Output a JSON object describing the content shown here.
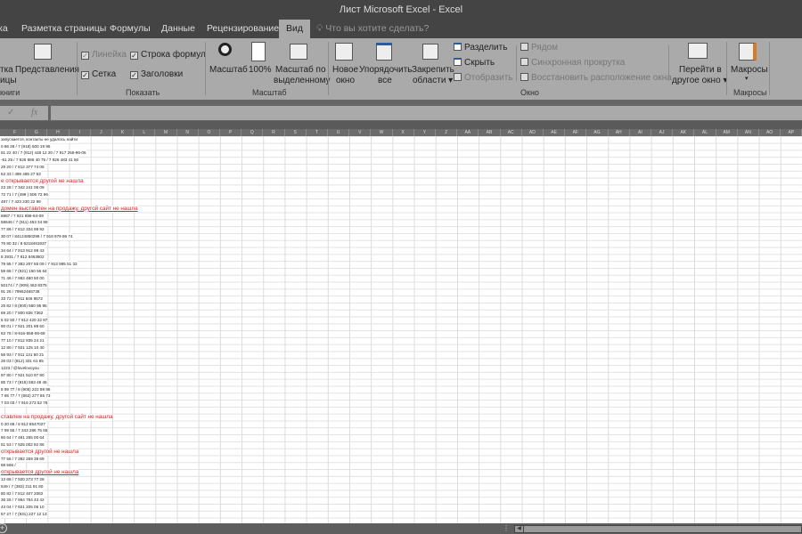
{
  "window": {
    "title": "Лист Microsoft Excel  -  Excel"
  },
  "tabs": [
    {
      "label": "ка"
    },
    {
      "label": "Разметка страницы"
    },
    {
      "label": "Формулы"
    },
    {
      "label": "Данные"
    },
    {
      "label": "Рецензирование"
    },
    {
      "label": "Вид",
      "active": true
    }
  ],
  "tell_me": "Что вы хотите сделать?",
  "ribbon": {
    "views": {
      "btn1": "тка",
      "btn1b": "ицы",
      "btn2": "Представления",
      "group": "книги"
    },
    "show": {
      "ruler": "Линейка",
      "formula_bar": "Строка формул",
      "gridlines": "Сетка",
      "headings": "Заголовки",
      "group": "Показать"
    },
    "zoom": {
      "zoom": "Масштаб",
      "p100": "100%",
      "sel1": "Масштаб по",
      "sel2": "выделенному",
      "group": "Масштаб"
    },
    "window": {
      "new1": "Новое",
      "new2": "окно",
      "arr1": "Упорядочить",
      "arr2": "все",
      "freeze1": "Закрепить",
      "freeze2": "области",
      "split": "Разделить",
      "hide": "Скрыть",
      "unhide": "Отобразить",
      "side": "Рядом",
      "sync": "Синхронная прокрутка",
      "reset": "Восстановить расположение окна",
      "switch1": "Перейти в",
      "switch2": "другое окно",
      "group": "Окно"
    },
    "macros": {
      "label": "Макросы",
      "group": "Макросы"
    }
  },
  "formula_bar": {
    "fx": "fx",
    "check": "✓",
    "value": ""
  },
  "columns": [
    "F",
    "G",
    "H",
    "I",
    "J",
    "K",
    "L",
    "M",
    "N",
    "O",
    "P",
    "Q",
    "R",
    "S",
    "T",
    "U",
    "V",
    "W",
    "X",
    "Y",
    "Z",
    "AA",
    "AB",
    "AC",
    "AD",
    "AE",
    "AF",
    "AG",
    "AH",
    "AI",
    "AJ",
    "AK",
    "AL",
    "AM",
    "AN",
    "AO",
    "AP"
  ],
  "rows": [
    {
      "text": "запускается, контакты не удалось найти"
    },
    {
      "text": "0 86 28 / 7 (918) 500 19 95"
    },
    {
      "text": "61 22 40 / 7 (812) 448 12 20 / 7 917 255-96-06"
    },
    {
      "text": "-61 25 / 7 926 886 40 75 / 7 926 483 41 50"
    },
    {
      "text": "29 20 / 7 812 377 74 06"
    },
    {
      "text": "53 33 / 499 485 27 53"
    },
    {
      "text": "е открывается другой не нашла",
      "red": true
    },
    {
      "text": "23 28 / 7 342 241 05 09"
    },
    {
      "text": "72 71 / 7 (499 ) 506 72 96"
    },
    {
      "text": "487 / 7 423 230 22 99"
    },
    {
      "text": " домен выставлен на продажу, другой сайт не нашла",
      "red": true,
      "u": true
    },
    {
      "text": "6887 / 7 921 896-84-09"
    },
    {
      "text": "58646 / 7 (911) 463 34 98"
    },
    {
      "text": "77 89 / 7 812 334 98 92"
    },
    {
      "text": "30 07 / 84124850298 / 7 918 979 86 74"
    },
    {
      "text": "76 80 32 / 8 9218461937"
    },
    {
      "text": "34 64 / 7 913 912 99 43"
    },
    {
      "text": "8 2931 / 7 812 8463802"
    },
    {
      "text": "79 95 / 7 383 207 55 09 / 7 913 985 51 33"
    },
    {
      "text": "59 68 / 7 (921) 150 56 64"
    },
    {
      "text": "71 46 / 7 962 480 50 00"
    },
    {
      "text": "50174 / 7 (909) 463 8375"
    },
    {
      "text": "91 26 / 79952465738"
    },
    {
      "text": "33 73 / 7 911 846 9572"
    },
    {
      "text": "25 82 / 8 (800) 550 95 95"
    },
    {
      "text": "69 20 / 7 800 836 7362"
    },
    {
      "text": "5 02 50 / 7 812 420 22 87"
    },
    {
      "text": "90 01 / 7 921 201 89 60"
    },
    {
      "text": "63 78 / 8-916-558-06-68"
    },
    {
      "text": "77 10 / 7 812 935 24 21"
    },
    {
      "text": "12 80 / 7 921 125 10 40"
    },
    {
      "text": "56 93 / 7 911 131 50 21"
    },
    {
      "text": "26 03 / (812) 331 61 85"
    },
    {
      "text": "1223 / @lovelovoyou"
    },
    {
      "text": "97 80 / 7 921 510 97 80"
    },
    {
      "text": "85 73 / 7 (916) 563 49 45"
    },
    {
      "text": "8 99 77 / 8 (905) 222 88 86"
    },
    {
      "text": "7 65 77 / 7 (862) 277 65 73"
    },
    {
      "text": "7 03 03 / 7 916 273 52 76"
    },
    {
      "text": ""
    },
    {
      "text": "ставлен на продажу, другой сайт не нашла",
      "red": true
    },
    {
      "text": "0 20 68 / 8 812 8547027"
    },
    {
      "text": "7 99 55 / 7 343 286 75 55"
    },
    {
      "text": "60 64 / 7 481 265 00 64"
    },
    {
      "text": "51 53 / 7 925 002 92 86"
    },
    {
      "text": " открывается другой не нашла",
      "red": true
    },
    {
      "text": "77 56 / 7 382 259 39 69"
    },
    {
      "text": "88 566 /"
    },
    {
      "text": " открывается другой не нашла",
      "red": true,
      "u": true
    },
    {
      "text": "12 68 / 7 920 273 77 28"
    },
    {
      "text": "549 / 7 (383) 211 91 80"
    },
    {
      "text": "80 82 / 7 812 407 2082"
    },
    {
      "text": "36 26 / 7 964 784 43 42"
    },
    {
      "text": "43 04 / 7 921 205 06 10"
    },
    {
      "text": "57 27 / 7 (931) 227 12 13"
    }
  ],
  "statusbar": {
    "add_sheet": "+",
    "dots": "⋮",
    "scroll_left": "◀"
  }
}
